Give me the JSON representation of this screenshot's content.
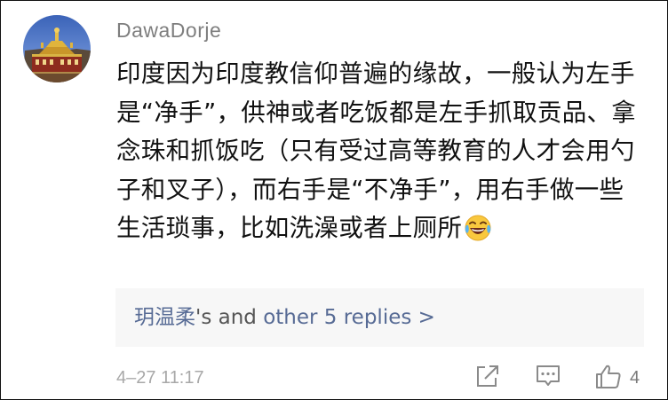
{
  "comment": {
    "username": "DawaDorje",
    "body": "印度因为印度教信仰普遍的缘故，一般认为左手是“净手”，供神或者吃饭都是左手抓取贡品、拿念珠和抓饭吃（只有受过高等教育的人才会用勺子和叉子），而右手是“不净手”，用右手做一些生活琐事，比如洗澡或者上厕所",
    "emoji": "laughing-with-tears",
    "timestamp": "4–27 11:17",
    "like_count": "4"
  },
  "replies": {
    "first_replier": "玥温柔",
    "connector": "'s and ",
    "more_link": "other 5 replies >"
  },
  "icons": {
    "share": "share-icon",
    "reply": "comment-icon",
    "like": "thumbs-up-icon"
  },
  "colors": {
    "link": "#576b95",
    "username": "#7e7e7e",
    "meta": "#a8a8a8",
    "replies_bg": "#f7f7f7"
  }
}
